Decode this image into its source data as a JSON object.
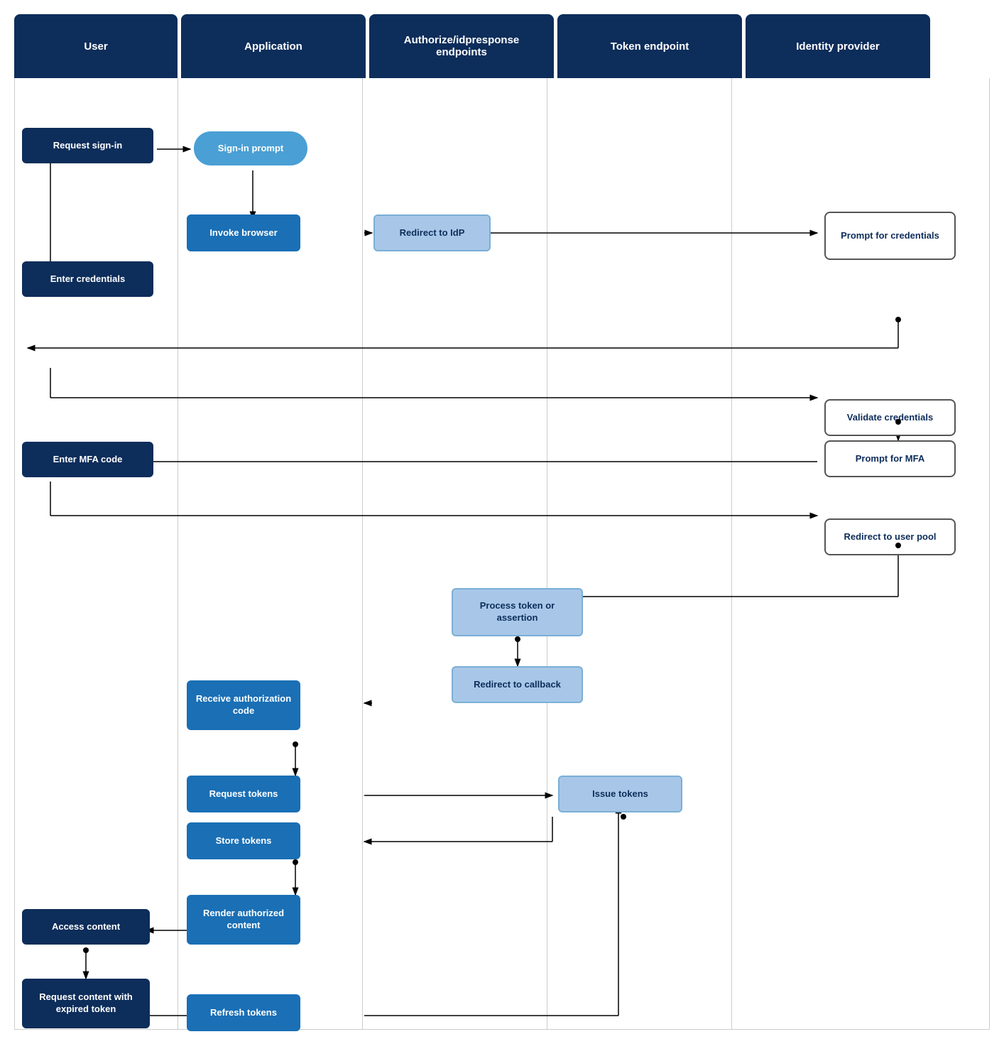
{
  "headers": [
    {
      "id": "col-user",
      "label": "User"
    },
    {
      "id": "col-app",
      "label": "Application"
    },
    {
      "id": "col-auth",
      "label": "Authorize/idpresponse\nendpoints"
    },
    {
      "id": "col-token",
      "label": "Token endpoint"
    },
    {
      "id": "col-idp",
      "label": "Identity provider"
    }
  ],
  "boxes": {
    "request_signin": {
      "label": "Request sign-in"
    },
    "signin_prompt": {
      "label": "Sign-in prompt"
    },
    "invoke_browser": {
      "label": "Invoke browser"
    },
    "redirect_idp": {
      "label": "Redirect to IdP"
    },
    "prompt_credentials": {
      "label": "Prompt for credentials"
    },
    "enter_credentials": {
      "label": "Enter credentials"
    },
    "validate_credentials": {
      "label": "Validate credentials"
    },
    "prompt_mfa": {
      "label": "Prompt for MFA"
    },
    "enter_mfa": {
      "label": "Enter MFA code"
    },
    "redirect_user_pool": {
      "label": "Redirect to user pool"
    },
    "process_token": {
      "label": "Process token or assertion"
    },
    "redirect_callback": {
      "label": "Redirect to callback"
    },
    "receive_auth_code": {
      "label": "Receive authorization code"
    },
    "request_tokens": {
      "label": "Request tokens"
    },
    "issue_tokens": {
      "label": "Issue tokens"
    },
    "store_tokens": {
      "label": "Store tokens"
    },
    "render_authorized": {
      "label": "Render authorized content"
    },
    "access_content": {
      "label": "Access content"
    },
    "request_expired": {
      "label": "Request content with expired token"
    },
    "refresh_tokens": {
      "label": "Refresh tokens"
    }
  }
}
